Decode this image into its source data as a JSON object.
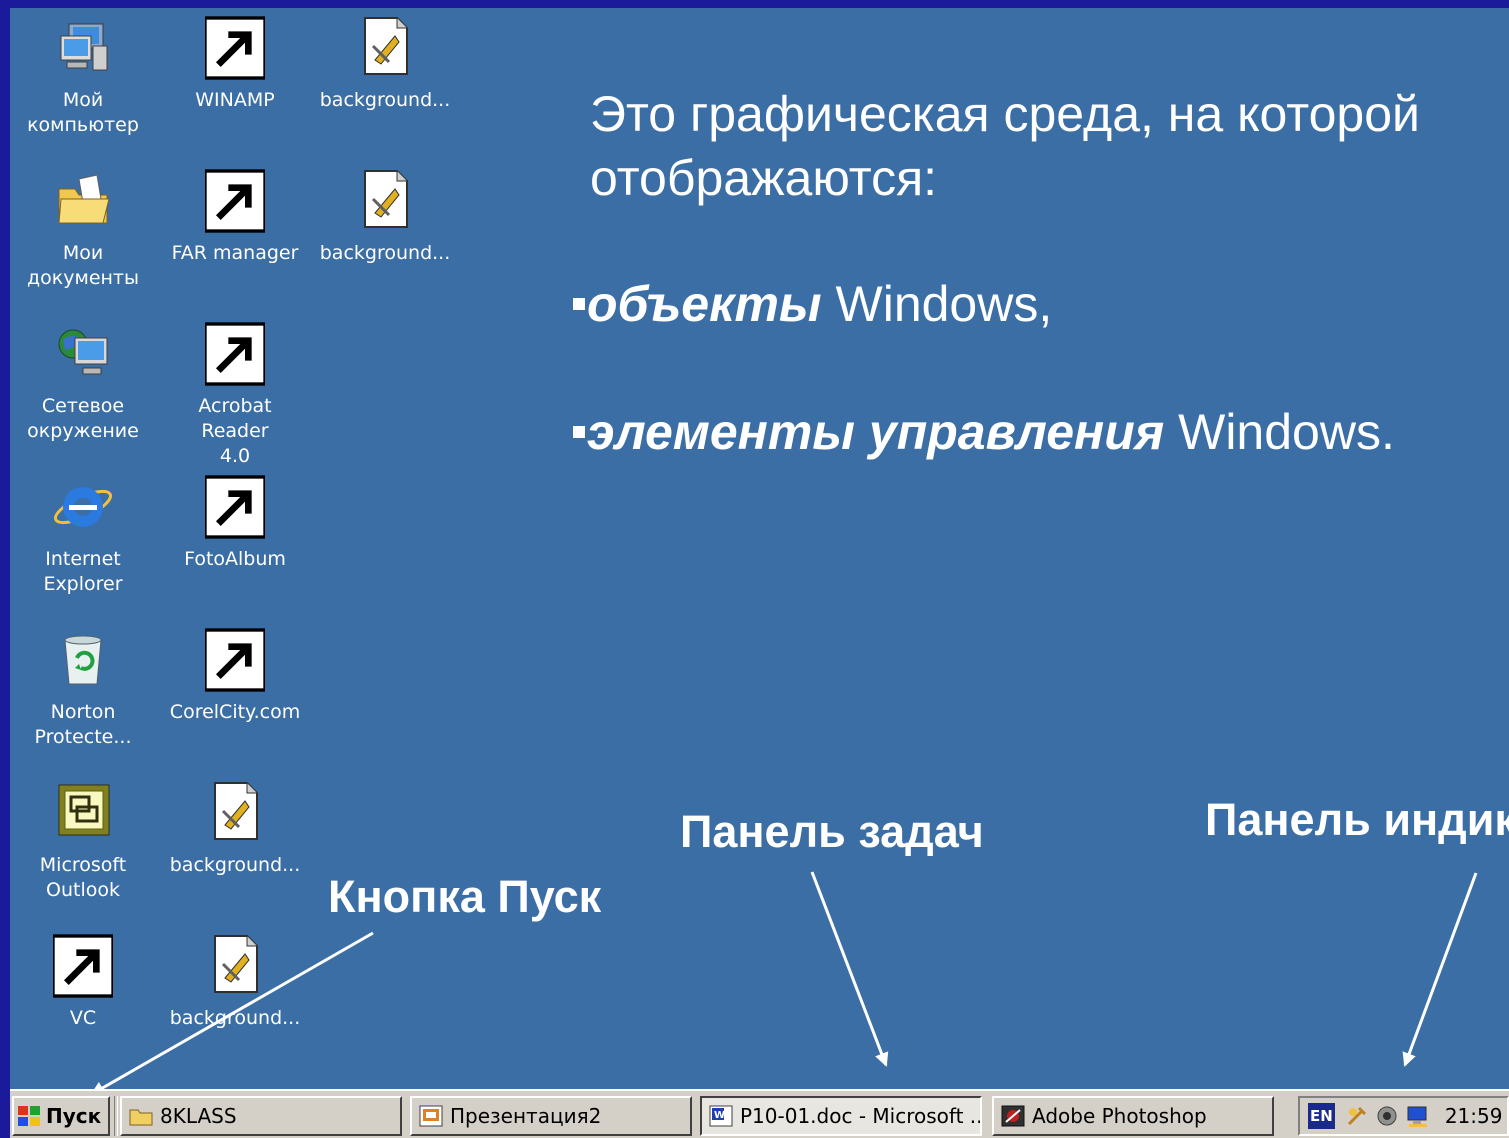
{
  "desktop": {
    "icons": [
      {
        "label": "Мой\nкомпьютер",
        "icon": "my-computer-icon"
      },
      {
        "label": "WINAMP",
        "icon": "winamp-icon"
      },
      {
        "label": "background...",
        "icon": "document-icon"
      },
      {
        "label": "Мои\nдокументы",
        "icon": "my-documents-icon"
      },
      {
        "label": "FAR manager",
        "icon": "far-manager-icon"
      },
      {
        "label": "background...",
        "icon": "document-icon"
      },
      {
        "label": "Сетевое\nокружение",
        "icon": "network-icon"
      },
      {
        "label": "Acrobat Reader\n4.0",
        "icon": "acrobat-icon"
      },
      {
        "label": "Internet\nExplorer",
        "icon": "internet-explorer-icon"
      },
      {
        "label": "FotoAlbum",
        "icon": "camera-icon"
      },
      {
        "label": "Norton\nProtecte...",
        "icon": "recycle-bin-icon"
      },
      {
        "label": "CorelCity.com",
        "icon": "globe-icon"
      },
      {
        "label": "Microsoft\nOutlook",
        "icon": "outlook-icon"
      },
      {
        "label": "background...",
        "icon": "document-icon"
      },
      {
        "label": "VC",
        "icon": "vc-icon"
      },
      {
        "label": "background...",
        "icon": "document-icon"
      }
    ]
  },
  "annotations": {
    "intro": "Это графическая среда, на которой отображаются:",
    "bullet1_em": "объекты",
    "bullet1_rest": " Windows,",
    "bullet2_em": "элементы управления",
    "bullet2_rest": " Windows.",
    "taskbar_callout": "Панель задач",
    "tray_callout": "Панель индикации",
    "start_callout": "Кнопка Пуск"
  },
  "taskbar": {
    "start_label": "Пуск",
    "buttons": [
      {
        "label": "8KLASS",
        "icon": "folder-icon"
      },
      {
        "label": "Презентация2",
        "icon": "powerpoint-icon"
      },
      {
        "label": "P10-01.doc - Microsoft ...",
        "icon": "word-icon"
      },
      {
        "label": "Adobe Photoshop",
        "icon": "photoshop-icon"
      }
    ],
    "tray": {
      "lang": "EN",
      "clock": "21:59"
    }
  },
  "colors": {
    "desktop": "#3a6ea5",
    "frame": "#1a1a9a",
    "taskbar": "#d4d0c8"
  }
}
